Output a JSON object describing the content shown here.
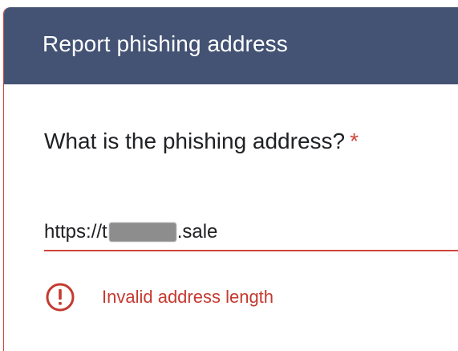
{
  "form": {
    "title": "Report phishing address",
    "question": "What is the phishing address?",
    "required_marker": "*",
    "answer": {
      "value_prefix": "https://t",
      "value_suffix": ".sale"
    },
    "error": {
      "message": "Invalid address length",
      "icon": "error-icon"
    }
  },
  "colors": {
    "header_bg": "#445374",
    "error": "#d0453a"
  }
}
